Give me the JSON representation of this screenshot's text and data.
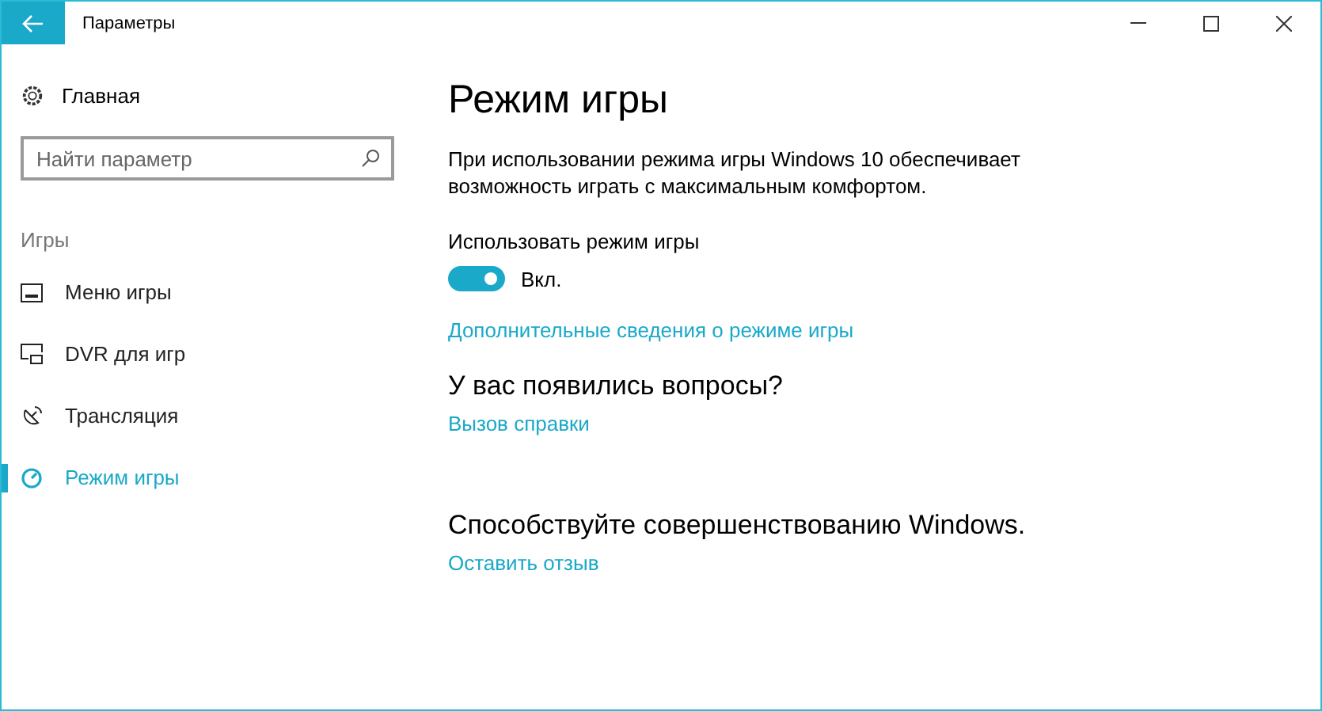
{
  "window": {
    "title": "Параметры"
  },
  "sidebar": {
    "home": "Главная",
    "search": {
      "placeholder": "Найти параметр"
    },
    "section": "Игры",
    "items": [
      {
        "label": "Меню игры",
        "selected": false
      },
      {
        "label": "DVR для игр",
        "selected": false
      },
      {
        "label": "Трансляция",
        "selected": false
      },
      {
        "label": "Режим игры",
        "selected": true
      }
    ]
  },
  "main": {
    "title": "Режим игры",
    "description": "При использовании режима игры Windows 10 обеспечивает возможность играть с максимальным комфортом.",
    "setting": {
      "label": "Использовать режим игры",
      "on": true,
      "state_text": "Вкл."
    },
    "more_link": "Дополнительные сведения о режиме игры",
    "questions": {
      "heading": "У вас появились вопросы?",
      "link": "Вызов справки"
    },
    "feedback": {
      "heading": "Способствуйте совершенствованию Windows.",
      "link": "Оставить отзыв"
    }
  }
}
